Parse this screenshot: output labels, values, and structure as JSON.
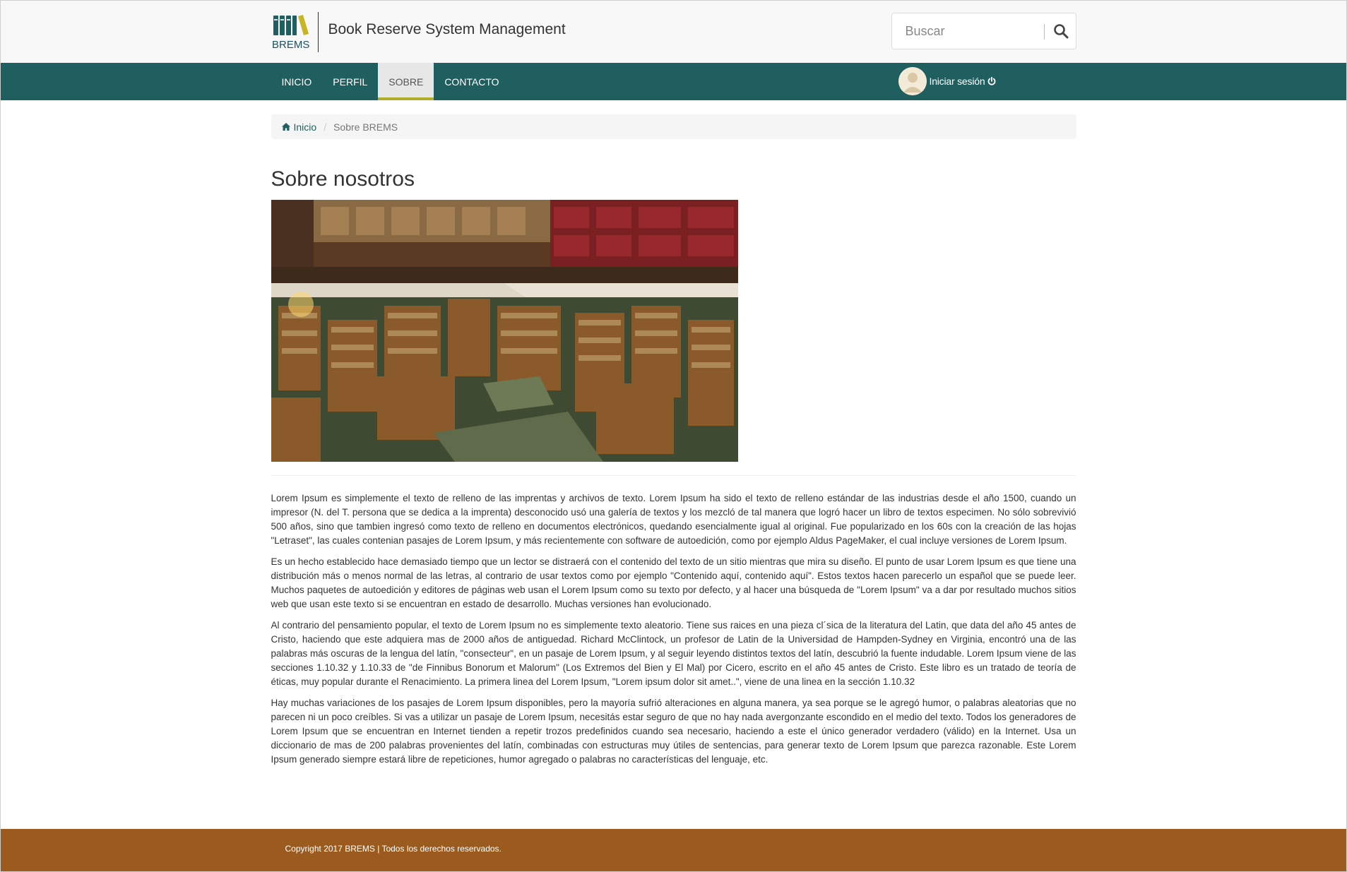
{
  "header": {
    "logo_text": "BREMS",
    "site_title": "Book Reserve System Management",
    "search": {
      "placeholder": "Buscar",
      "icon": "search-icon"
    }
  },
  "nav": {
    "items": [
      {
        "label": "INICIO"
      },
      {
        "label": "PERFIL"
      },
      {
        "label": "SOBRE",
        "active": true
      },
      {
        "label": "CONTACTO"
      }
    ],
    "login_label": "Iniciar sesión",
    "login_icon": "power-icon"
  },
  "breadcrumb": {
    "home_label": "Inicio",
    "home_icon": "home-icon",
    "current": "Sobre BREMS"
  },
  "page": {
    "title": "Sobre nosotros",
    "paragraphs": [
      "Lorem Ipsum es simplemente el texto de relleno de las imprentas y archivos de texto. Lorem Ipsum ha sido el texto de relleno estándar de las industrias desde el año 1500, cuando un impresor (N. del T. persona que se dedica a la imprenta) desconocido usó una galería de textos y los mezcló de tal manera que logró hacer un libro de textos especimen. No sólo sobrevivió 500 años, sino que tambien ingresó como texto de relleno en documentos electrónicos, quedando esencialmente igual al original. Fue popularizado en los 60s con la creación de las hojas \"Letraset\", las cuales contenian pasajes de Lorem Ipsum, y más recientemente con software de autoedición, como por ejemplo Aldus PageMaker, el cual incluye versiones de Lorem Ipsum.",
      "Es un hecho establecido hace demasiado tiempo que un lector se distraerá con el contenido del texto de un sitio mientras que mira su diseño. El punto de usar Lorem Ipsum es que tiene una distribución más o menos normal de las letras, al contrario de usar textos como por ejemplo \"Contenido aquí, contenido aquí\". Estos textos hacen parecerlo un español que se puede leer. Muchos paquetes de autoedición y editores de páginas web usan el Lorem Ipsum como su texto por defecto, y al hacer una búsqueda de \"Lorem Ipsum\" va a dar por resultado muchos sitios web que usan este texto si se encuentran en estado de desarrollo. Muchas versiones han evolucionado.",
      "Al contrario del pensamiento popular, el texto de Lorem Ipsum no es simplemente texto aleatorio. Tiene sus raices en una pieza cl´sica de la literatura del Latin, que data del año 45 antes de Cristo, haciendo que este adquiera mas de 2000 años de antiguedad. Richard McClintock, un profesor de Latin de la Universidad de Hampden-Sydney en Virginia, encontró una de las palabras más oscuras de la lengua del latín, \"consecteur\", en un pasaje de Lorem Ipsum, y al seguir leyendo distintos textos del latín, descubrió la fuente indudable. Lorem Ipsum viene de las secciones 1.10.32 y 1.10.33 de \"de Finnibus Bonorum et Malorum\" (Los Extremos del Bien y El Mal) por Cicero, escrito en el año 45 antes de Cristo. Este libro es un tratado de teoría de éticas, muy popular durante el Renacimiento. La primera linea del Lorem Ipsum, \"Lorem ipsum dolor sit amet..\", viene de una linea en la sección 1.10.32",
      "Hay muchas variaciones de los pasajes de Lorem Ipsum disponibles, pero la mayoría sufrió alteraciones en alguna manera, ya sea porque se le agregó humor, o palabras aleatorias que no parecen ni un poco creíbles. Si vas a utilizar un pasaje de Lorem Ipsum, necesitás estar seguro de que no hay nada avergonzante escondido en el medio del texto. Todos los generadores de Lorem Ipsum que se encuentran en Internet tienden a repetir trozos predefinidos cuando sea necesario, haciendo a este el único generador verdadero (válido) en la Internet. Usa un diccionario de mas de 200 palabras provenientes del latín, combinadas con estructuras muy útiles de sentencias, para generar texto de Lorem Ipsum que parezca razonable. Este Lorem Ipsum generado siempre estará libre de repeticiones, humor agregado o palabras no características del lenguaje, etc."
    ]
  },
  "footer": {
    "copyright": "Copyright 2017 BREMS | Todos los derechos reservados."
  },
  "colors": {
    "navbar": "#1f5f5f",
    "active_underline": "#b3ae2a",
    "footer": "#9b5b1f",
    "link": "#1f5f5f"
  }
}
